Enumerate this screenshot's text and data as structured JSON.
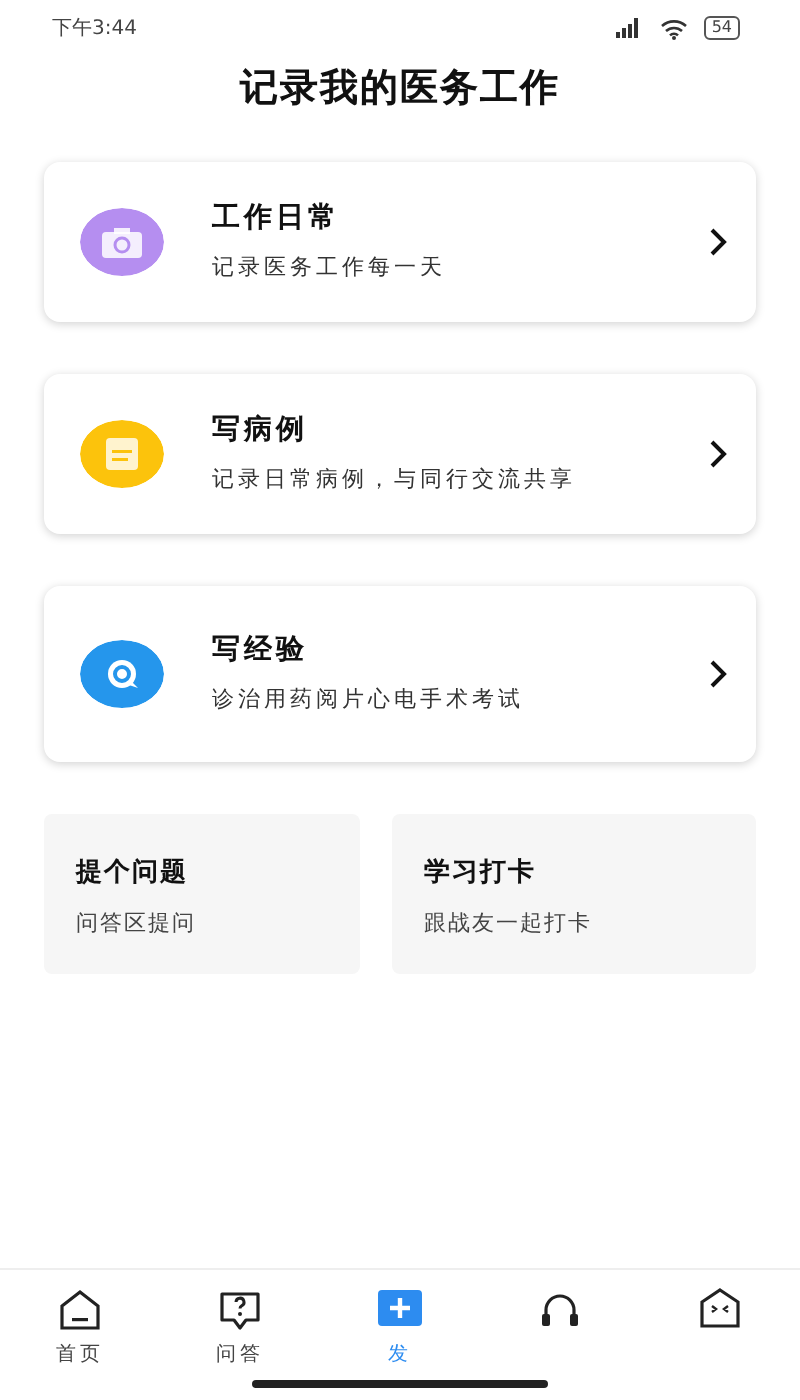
{
  "status_bar": {
    "time": "下午3:44",
    "battery": "54"
  },
  "title": "记录我的医务工作",
  "entries": [
    {
      "kind": "camera",
      "color": "#b58ef0",
      "title": "工作日常",
      "subtitle": "记录医务工作每一天"
    },
    {
      "kind": "note",
      "color": "#fcc30c",
      "title": "写病例",
      "subtitle": "记录日常病例，与同行交流共享"
    },
    {
      "kind": "chat",
      "color": "#2596ec",
      "title": "写经验",
      "subtitle": "诊治用药阅片心电手术考试"
    }
  ],
  "shortcuts": [
    {
      "title": "提个问题",
      "subtitle": "问答区提问"
    },
    {
      "title": "学习打卡",
      "subtitle": "跟战友一起打卡"
    }
  ],
  "tabs": [
    {
      "kind": "home",
      "label": "首页",
      "selected": false
    },
    {
      "kind": "question",
      "label": "问答",
      "selected": false
    },
    {
      "kind": "plus",
      "label": "发",
      "selected": true
    },
    {
      "kind": "headset",
      "selected": false
    },
    {
      "kind": "face",
      "selected": false
    }
  ]
}
